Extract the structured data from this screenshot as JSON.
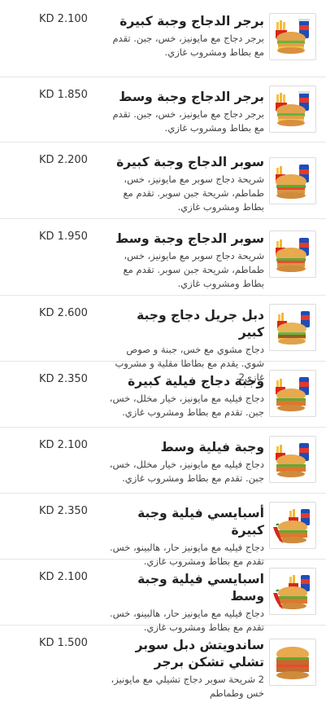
{
  "currency_items": [
    {
      "title": "برجر الدجاج وجبة كبيرة",
      "desc": "برجر دجاج مع مايونيز، خس، جبن. تقدم مع بطاط ومشروب غازي.",
      "price": "KD 2.100",
      "img": "burger-combo"
    },
    {
      "title": "برجر الدجاج وجبة وسط",
      "desc": "برجر دجاج مع مايونيز، خس، جبن. تقدم مع بطاط ومشروب غازي.",
      "price": "KD 1.850",
      "img": "burger-combo"
    },
    {
      "title": "سوبر الدجاج وجبة كبيرة",
      "desc": "شريحة دجاج سوبر مع مايونيز، خس، طماطم، شريحة جبن سوبر. تقدم مع بطاط ومشروب غازي.",
      "price": "KD 2.200",
      "img": "super-combo"
    },
    {
      "title": "سوبر الدجاج وجبة وسط",
      "desc": "شريحة دجاج سوبر مع مايونيز، خس، طماطم، شريحة جبن سوبر. تقدم مع بطاط ومشروب غازي.",
      "price": "KD 1.950",
      "img": "super-combo"
    },
    {
      "title": "دبل جريل دجاج وجبة كبير",
      "desc": "دجاج مشوي مع خس، جبنة و صوص شوي. يقدم مع بطاطا مقلية و مشروب غازي2",
      "price": "KD 2.600",
      "img": "grill-combo"
    },
    {
      "title": "وجبة دجاج فيلية كبيرة",
      "desc": "دجاج فيليه مع مايونيز، خيار مخلل، خس، جبن. تقدم مع بطاط ومشروب غازي.",
      "price": "KD 2.350",
      "img": "fillet-combo"
    },
    {
      "title": "وجبة فيلية وسط",
      "desc": "دجاج فيليه مع مايونيز، خيار مخلل، خس، جبن. تقدم مع بطاط ومشروب غازي.",
      "price": "KD 2.100",
      "img": "fillet-combo"
    },
    {
      "title": "أسبايسي فيلية وجبة كبيرة",
      "desc": "دجاج فيليه مع مايونيز حار، هالبينو، خس. تقدم مع بطاط ومشروب غازي.",
      "price": "KD 2.350",
      "img": "spicy-combo"
    },
    {
      "title": "اسبايسي فيلية وجبة وسط",
      "desc": "دجاج فيليه مع مايونيز حار، هالبينو، خس. تقدم مع بطاط ومشروب غازي.",
      "price": "KD 2.100",
      "img": "spicy-combo"
    },
    {
      "title": "ساندويتش دبل سوبر تشلي تشكن برجر",
      "desc": "2 شريحة سوبر دجاج تشيلي مع مايونيز، خس وطماطم",
      "price": "KD 1.500",
      "img": "double-sandwich"
    }
  ]
}
